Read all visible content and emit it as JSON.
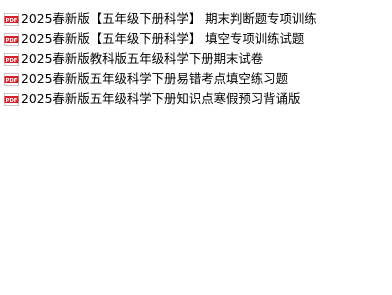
{
  "files": [
    {
      "name": "2025春新版【五年级下册科学】 期末判断题专项训练",
      "icon": "pdf-icon"
    },
    {
      "name": "2025春新版【五年级下册科学】 填空专项训练试题",
      "icon": "pdf-icon"
    },
    {
      "name": "2025春新版教科版五年级科学下册期末试卷",
      "icon": "pdf-icon"
    },
    {
      "name": "2025春新版五年级科学下册易错考点填空练习题",
      "icon": "pdf-icon"
    },
    {
      "name": "2025春新版五年级科学下册知识点寒假预习背诵版",
      "icon": "pdf-icon"
    }
  ],
  "colors": {
    "icon_red": "#d0202a",
    "text": "#000000",
    "background": "#ffffff"
  }
}
